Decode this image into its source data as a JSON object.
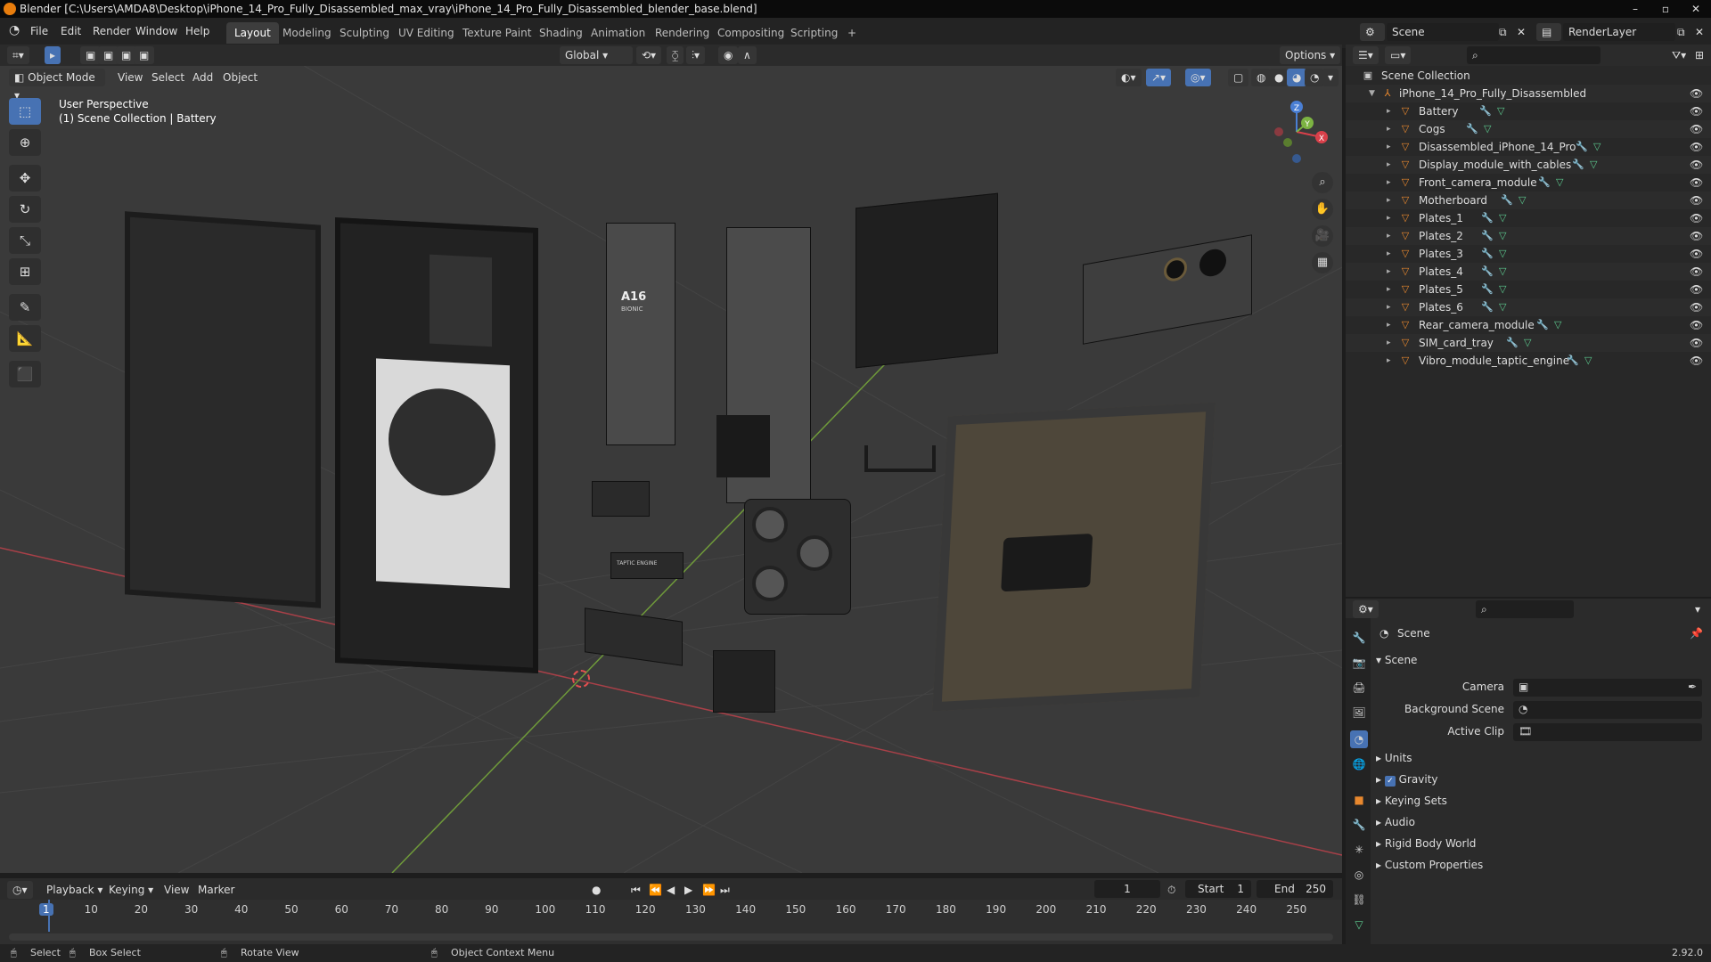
{
  "window": {
    "title": "Blender [C:\\Users\\AMDA8\\Desktop\\iPhone_14_Pro_Fully_Disassembled_max_vray\\iPhone_14_Pro_Fully_Disassembled_blender_base.blend]"
  },
  "menu": [
    "File",
    "Edit",
    "Render",
    "Window",
    "Help"
  ],
  "workspaces": [
    "Layout",
    "Modeling",
    "Sculpting",
    "UV Editing",
    "Texture Paint",
    "Shading",
    "Animation",
    "Rendering",
    "Compositing",
    "Scripting"
  ],
  "active_workspace": "Layout",
  "scene_selector": "Scene",
  "render_layer": "RenderLayer",
  "viewport": {
    "transform_orientation": "Global",
    "options_label": "Options",
    "mode": "Object Mode",
    "header_menus": [
      "View",
      "Select",
      "Add",
      "Object"
    ],
    "info_line1": "User Perspective",
    "info_line2": "(1) Scene Collection | Battery",
    "gizmo_axes": {
      "x": "X",
      "y": "Y",
      "z": "Z"
    }
  },
  "outliner": {
    "root": "Scene Collection",
    "collection": "iPhone_14_Pro_Fully_Disassembled",
    "objects": [
      "Battery",
      "Cogs",
      "Disassembled_iPhone_14_Pro",
      "Display_module_with_cables",
      "Front_camera_module",
      "Motherboard",
      "Plates_1",
      "Plates_2",
      "Plates_3",
      "Plates_4",
      "Plates_5",
      "Plates_6",
      "Rear_camera_module",
      "SIM_card_tray",
      "Vibro_module_taptic_engine"
    ]
  },
  "properties": {
    "context": "Scene",
    "panel": "Scene",
    "fields": [
      {
        "label": "Camera",
        "value": ""
      },
      {
        "label": "Background Scene",
        "value": ""
      },
      {
        "label": "Active Clip",
        "value": ""
      }
    ],
    "sections": [
      "Units",
      "Gravity",
      "Keying Sets",
      "Audio",
      "Rigid Body World",
      "Custom Properties"
    ],
    "gravity_checked": true
  },
  "timeline": {
    "menus": [
      "Playback",
      "Keying",
      "View",
      "Marker"
    ],
    "current_frame": "1",
    "start_label": "Start",
    "start": "1",
    "end_label": "End",
    "end": "250",
    "ticks": [
      "1",
      "10",
      "20",
      "30",
      "40",
      "50",
      "60",
      "70",
      "80",
      "90",
      "100",
      "110",
      "120",
      "130",
      "140",
      "150",
      "160",
      "170",
      "180",
      "190",
      "200",
      "210",
      "220",
      "230",
      "240",
      "250"
    ]
  },
  "statusbar": {
    "select": "Select",
    "box_select": "Box Select",
    "rotate_view": "Rotate View",
    "context_menu": "Object Context Menu",
    "version": "2.92.0"
  },
  "parts": {
    "chip_label": "A16",
    "chip_sub": "BIONIC",
    "taptic_label": "TAPTIC ENGINE"
  },
  "colors": {
    "accent": "#4772b3",
    "object_icon": "#e8882e",
    "mesh_icon": "#5cc98e",
    "x_axis": "#d9404a",
    "y_axis": "#7cb342",
    "z_axis": "#4a7fd4"
  }
}
